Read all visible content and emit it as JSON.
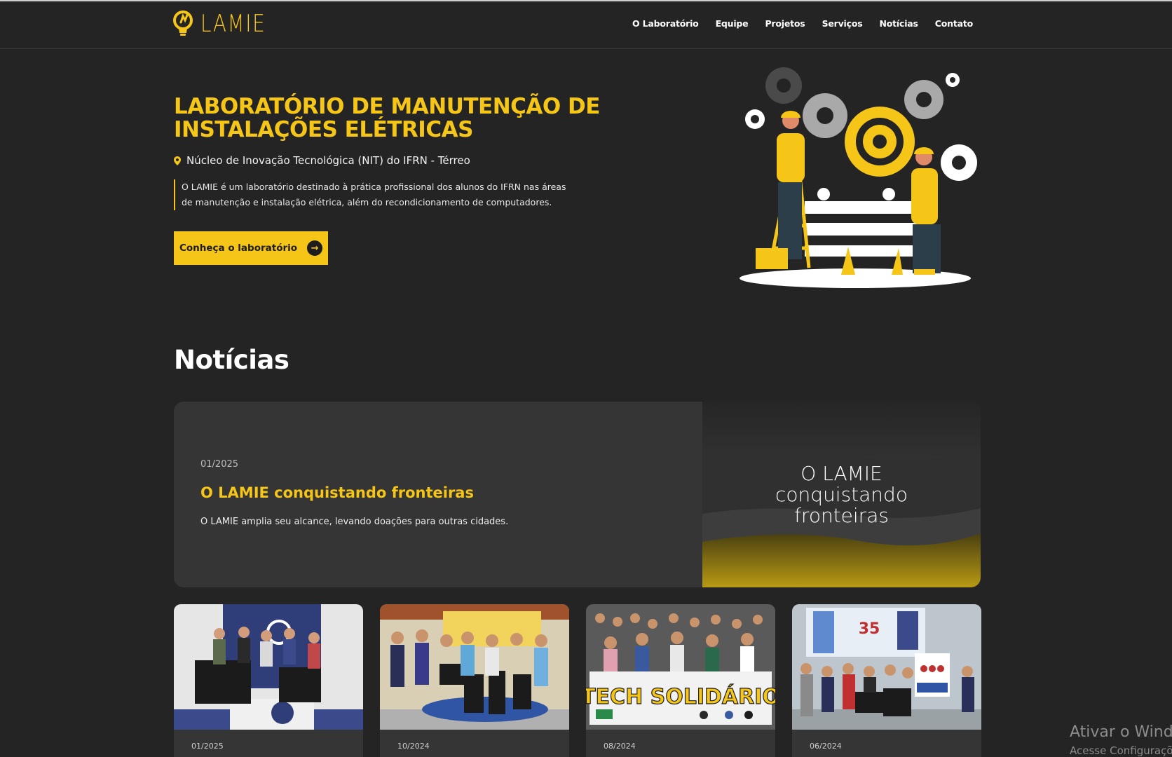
{
  "brand": {
    "logo_text": "LAMIE",
    "accent": "#f5c518",
    "background": "#242424"
  },
  "nav": {
    "items": [
      "O Laboratório",
      "Equipe",
      "Projetos",
      "Serviços",
      "Notícias",
      "Contato"
    ]
  },
  "hero": {
    "title_line1": "LABORATÓRIO DE MANUTENÇÃO DE",
    "title_line2": "INSTALAÇÕES ELÉTRICAS",
    "location": "Núcleo de Inovação Tecnológica (NIT) do IFRN - Térreo",
    "description_line1": "O LAMIE é um laboratório destinado à prática profissional dos alunos do IFRN nas áreas",
    "description_line2": "de manutenção e instalação elétrica, além do recondicionamento de computadores.",
    "cta_label": "Conheça o laboratório",
    "illustration_icon": "workers-gears-illustration"
  },
  "news": {
    "section_title": "Notícias",
    "featured": {
      "date": "01/2025",
      "headline": "O LAMIE conquistando fronteiras",
      "summary": "O LAMIE amplia seu alcance, levando doações para outras cidades.",
      "image_text_line1": "O LAMIE",
      "image_text_line2": "conquistando",
      "image_text_line3": "fronteiras"
    },
    "cards": [
      {
        "date": "01/2025",
        "photo": "donation-group-photo"
      },
      {
        "date": "10/2024",
        "photo": "donation-group-photo"
      },
      {
        "date": "08/2024",
        "photo": "tech-solidario-banner-photo",
        "banner_text": "TECH SOLIDÁRIO"
      },
      {
        "date": "06/2024",
        "photo": "donation-group-photo",
        "sign_text": "35"
      }
    ]
  },
  "os_watermark": {
    "line1": "Ativar o Windows",
    "line2": "Acesse Configurações"
  }
}
